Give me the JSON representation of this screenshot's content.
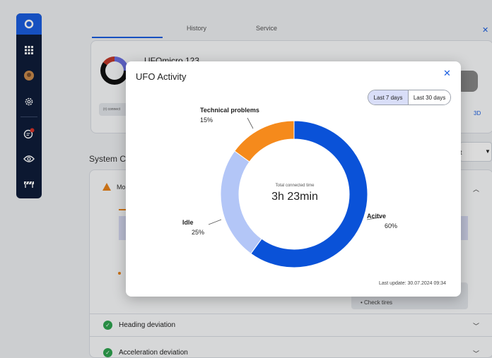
{
  "background": {
    "tabs": [
      "History",
      "Service"
    ],
    "device_name": "UFOmicro 123",
    "connect_label": "(•) connect",
    "view_3d_label": "3D",
    "system_title": "System C",
    "select_value": "t",
    "warning_item_label": "Mo",
    "check_tires": "• Check tires",
    "rows": [
      {
        "label": "Heading deviation"
      },
      {
        "label": "Acceleration deviation"
      }
    ]
  },
  "modal": {
    "title": "UFO Activity",
    "close_icon": "close-icon",
    "range_options": [
      "Last 7 days",
      "Last 30 days"
    ],
    "range_selected": "Last 7 days",
    "center_label": "Total connected time",
    "center_value": "3h 23min",
    "last_update": "Last update: 30.07.2024 09:34"
  },
  "chart_data": {
    "type": "pie",
    "series": [
      {
        "name": "Acitve",
        "value": 60,
        "label": "60%",
        "color": "#0a52d8"
      },
      {
        "name": "Idle",
        "value": 25,
        "label": "25%",
        "color": "#b3c6f7"
      },
      {
        "name": "Technical problems",
        "value": 15,
        "label": "15%",
        "color": "#f58a1c"
      }
    ]
  },
  "colors": {
    "accent": "#1a5ee0",
    "sidebar_bg": "#0f1d3a",
    "warning": "#e8831a",
    "success": "#2ea44f"
  }
}
